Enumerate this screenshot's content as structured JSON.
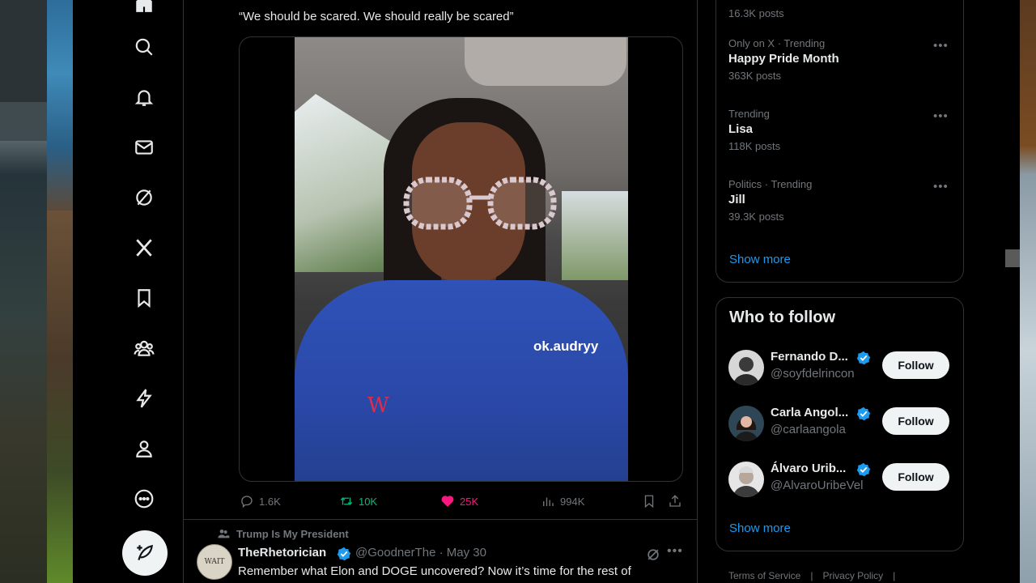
{
  "nav": {
    "items": [
      {
        "name": "home",
        "icon": "home-icon"
      },
      {
        "name": "explore",
        "icon": "search-icon"
      },
      {
        "name": "notifications",
        "icon": "bell-icon"
      },
      {
        "name": "messages",
        "icon": "mail-icon"
      },
      {
        "name": "grok",
        "icon": "grok-icon"
      },
      {
        "name": "premium",
        "icon": "x-logo-icon"
      },
      {
        "name": "bookmarks",
        "icon": "bookmark-icon"
      },
      {
        "name": "communities",
        "icon": "communities-icon"
      },
      {
        "name": "verified-orgs",
        "icon": "lightning-icon"
      },
      {
        "name": "profile",
        "icon": "person-icon"
      },
      {
        "name": "more",
        "icon": "more-circle-icon"
      }
    ],
    "compose_icon": "compose-icon"
  },
  "tweet": {
    "quote_text": "“We should be scared. We should really be scared”",
    "video_watermark": "ok.audryy",
    "video_logo": "W",
    "actions": {
      "replies": "1.6K",
      "reposts": "10K",
      "likes": "25K",
      "views": "994K"
    }
  },
  "next_tweet": {
    "social_context": "Trump Is My President",
    "avatar_text": "WAIT",
    "name": "TheRhetorician",
    "handle": "@GoodnerThe · May 30",
    "text": "Remember what Elon and DOGE uncovered?  Now it’s time for the rest of"
  },
  "trends": {
    "items": [
      {
        "meta": "",
        "title": "",
        "count": "16.3K posts"
      },
      {
        "meta": "Only on X · Trending",
        "title": "Happy Pride Month",
        "count": "363K posts"
      },
      {
        "meta": "Trending",
        "title": "Lisa",
        "count": "118K posts"
      },
      {
        "meta": "Politics · Trending",
        "title": "Jill",
        "count": "39.3K posts"
      }
    ],
    "show_more": "Show more"
  },
  "who_to_follow": {
    "title": "Who to follow",
    "users": [
      {
        "name": "Fernando D...",
        "handle": "@soyfdelrincon",
        "button": "Follow"
      },
      {
        "name": "Carla Angol...",
        "handle": "@carlaangola",
        "button": "Follow"
      },
      {
        "name": "Álvaro Urib...",
        "handle": "@AlvaroUribeVel",
        "button": "Follow"
      }
    ],
    "show_more": "Show more"
  },
  "footer": {
    "terms": "Terms of Service",
    "privacy": "Privacy Policy",
    "sep": "|"
  },
  "colors": {
    "accent": "#1d9bf0",
    "repost": "#00ba7c",
    "like": "#f91880",
    "muted": "#71767b",
    "border": "#2f3336"
  }
}
